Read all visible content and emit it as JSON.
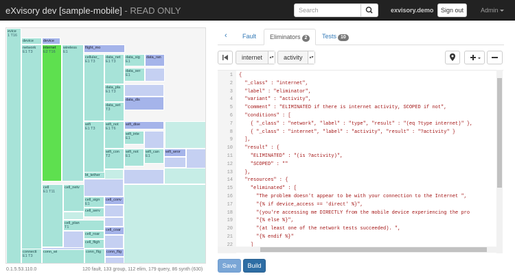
{
  "header": {
    "brand": "eXvisory dev [sample-mobile]",
    "brand_suffix": " - READ ONLY",
    "search_placeholder": "Search",
    "account": "exvisory.demo",
    "signout": "Sign out",
    "admin": "Admin"
  },
  "treemap": {
    "cells": [
      {
        "label": "evice",
        "sub": "1 T16",
        "style": "t"
      },
      {
        "label": "device",
        "sub": "",
        "style": "t"
      },
      {
        "label": "device",
        "sub": "",
        "style": "b"
      },
      {
        "label": "network",
        "sub": "E1 T3",
        "style": "t"
      },
      {
        "label": "internet",
        "sub": "E2 T16",
        "style": "g"
      },
      {
        "label": "wireless",
        "sub": "E1",
        "style": "t"
      },
      {
        "label": "flight_mo",
        "sub": "",
        "style": "b"
      },
      {
        "label": "cellular_",
        "sub": "E1 T3",
        "style": "t"
      },
      {
        "label": "data_net",
        "sub": "E1 T3",
        "style": "t"
      },
      {
        "label": "data_sig",
        "sub": "E1",
        "style": "t"
      },
      {
        "label": "data_ran",
        "sub": "",
        "style": "b"
      },
      {
        "label": "data_ser",
        "sub": "E1",
        "style": "t"
      },
      {
        "label": "data_pla",
        "sub": "E1 T3",
        "style": "t"
      },
      {
        "label": "data_set",
        "sub": "T3",
        "style": "t"
      },
      {
        "label": "data_dis",
        "sub": "",
        "style": "b"
      },
      {
        "label": "wifi",
        "sub": "E1 T3",
        "style": "t"
      },
      {
        "label": "wifi_not",
        "sub": "E1 T6",
        "style": "t"
      },
      {
        "label": "wifi_dise",
        "sub": "",
        "style": "b"
      },
      {
        "label": "wifi_inte",
        "sub": "E1",
        "style": "t"
      },
      {
        "label": "wifi_con",
        "sub": "T2",
        "style": "t"
      },
      {
        "label": "wifi_not",
        "sub": "E1",
        "style": "t"
      },
      {
        "label": "wifi_can",
        "sub": "E1",
        "style": "t"
      },
      {
        "label": "wifi_wror",
        "sub": "",
        "style": "b"
      },
      {
        "label": "bt_tether",
        "sub": "",
        "style": "t"
      },
      {
        "label": "cell",
        "sub": "E1 T11",
        "style": "t"
      },
      {
        "label": "cell_netv",
        "sub": "",
        "style": "t"
      },
      {
        "label": "cell_sign",
        "sub": "E1",
        "style": "t"
      },
      {
        "label": "cell_conv",
        "sub": "",
        "style": "b"
      },
      {
        "label": "cell_serv",
        "sub": "",
        "style": "t"
      },
      {
        "label": "cell_plan",
        "sub": "T1",
        "style": "t"
      },
      {
        "label": "cell_roar",
        "sub": "",
        "style": "t"
      },
      {
        "label": "cell_coar",
        "sub": "",
        "style": "b"
      },
      {
        "label": "cell_fligh",
        "sub": "",
        "style": "t"
      },
      {
        "label": "connecti",
        "sub": "E1 T3",
        "style": "t"
      },
      {
        "label": "conn_wi",
        "sub": "",
        "style": "t"
      },
      {
        "label": "conn_flig",
        "sub": "",
        "style": "t"
      },
      {
        "label": "conn_flig",
        "sub": "",
        "style": "b"
      }
    ],
    "version": "0.1.5.53.110.0",
    "stats": "120 fault, 133 group, 112 elim, 179 query, 86 synth (630)"
  },
  "tabs": [
    {
      "label": "Fault",
      "badge": ""
    },
    {
      "label": "Eliminators",
      "badge": "2"
    },
    {
      "label": "Tests",
      "badge": "10"
    }
  ],
  "toolbar": {
    "parent_select": "internet",
    "variant_select": "activity"
  },
  "editor": {
    "lines": [
      {
        "n": "1",
        "code": "{"
      },
      {
        "n": "2",
        "code": "  \"_class\" : \"internet\","
      },
      {
        "n": "3",
        "code": "  \"label\" : \"eliminator\","
      },
      {
        "n": "4",
        "code": "  \"variant\" : \"activity\","
      },
      {
        "n": "5",
        "code": "  \"comment\" : \"ELIMINATED if there is internet activity, SCOPED if not\","
      },
      {
        "n": "6",
        "code": "  \"conditions\" : ["
      },
      {
        "n": "7",
        "code": "    { \"_class\" : \"network\", \"label\" : \"type\", \"result\" : \"(eq ?type internet)\" },"
      },
      {
        "n": "8",
        "code": "    { \"_class\" : \"internet\", \"label\" : \"activity\", \"result\" : \"?activity\" }"
      },
      {
        "n": "9",
        "code": "  ],"
      },
      {
        "n": "10",
        "code": "  \"result\" : {"
      },
      {
        "n": "11",
        "code": "    \"ELIMINATED\" : \"(is ?activity)\","
      },
      {
        "n": "12",
        "code": "    \"SCOPED\" : \"\""
      },
      {
        "n": "13",
        "code": "  },"
      },
      {
        "n": "14",
        "code": "  \"resources\" : {"
      },
      {
        "n": "15",
        "code": "    \"eliminated\" : ["
      },
      {
        "n": "16",
        "code": "      \"The problem doesn't appear to be with your connection to the Internet \","
      },
      {
        "n": "17",
        "code": "      \"{% if device_access == 'direct' %}\","
      },
      {
        "n": "18",
        "code": "      \"(you're accessing me DIRECTLY from the mobile device experiencing the pro"
      },
      {
        "n": "19",
        "code": "      \"{% else %}\","
      },
      {
        "n": "20",
        "code": "      \"(at least one of the network tests succeeded). \","
      },
      {
        "n": "21",
        "code": "      \"{% endif %}\""
      },
      {
        "n": "22",
        "code": "    ]"
      }
    ]
  },
  "actions": {
    "save": "Save",
    "build": "Build"
  }
}
